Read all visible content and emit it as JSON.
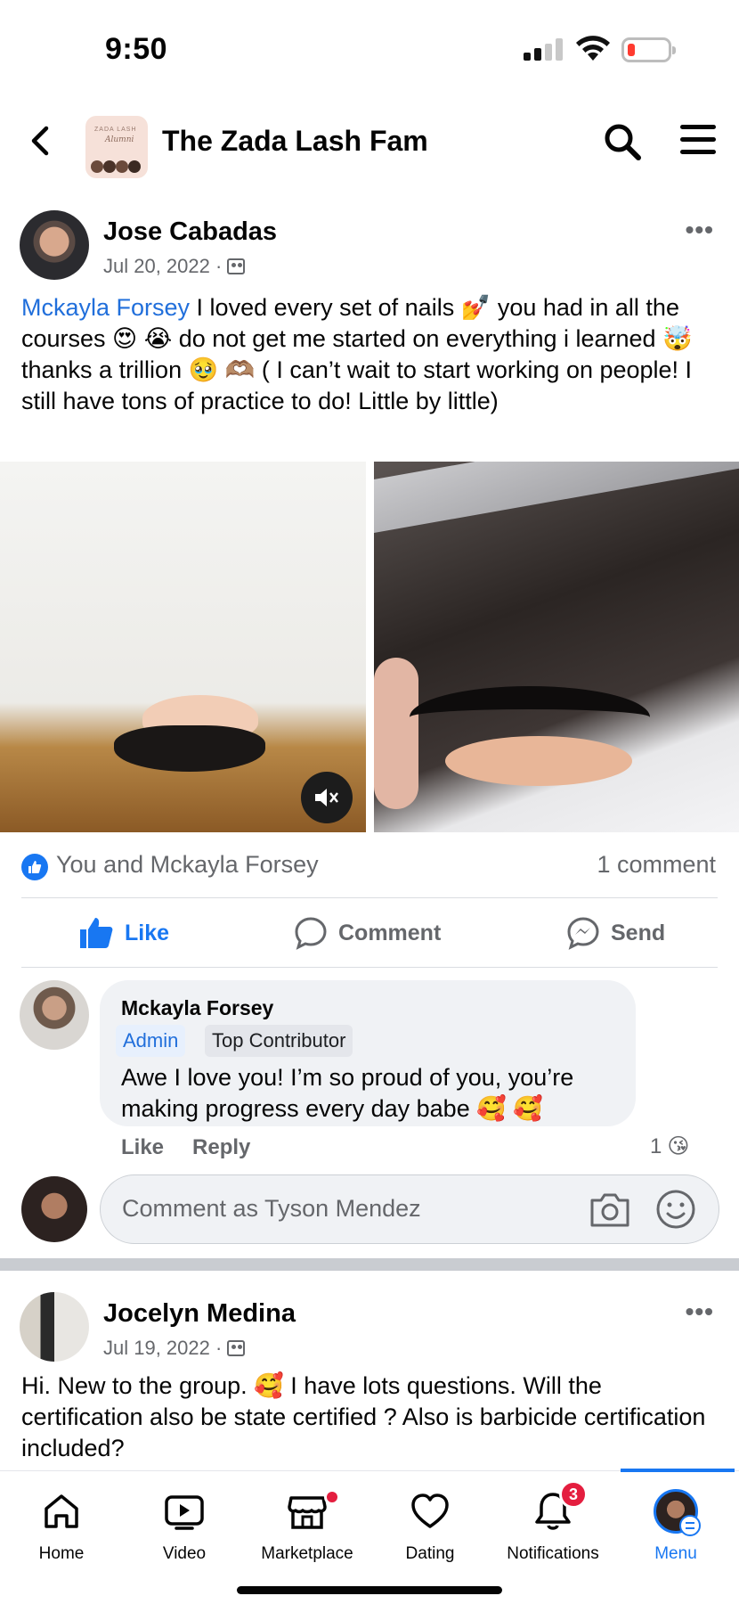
{
  "status_bar": {
    "time": "9:50"
  },
  "header": {
    "title": "The Zada Lash Fam",
    "thumb_line1": "ZADA LASH",
    "thumb_line2": "Alumni"
  },
  "post1": {
    "author": "Jose Cabadas",
    "date": "Jul 20, 2022 ·",
    "more": "•••",
    "mention": "Mckayla Forsey",
    "text_rest": " I loved every set of nails 💅 you had in all the courses 😍 😭 do not get me started on everything i learned 🤯 thanks a trillion 🥹 🫶🏽 ( I can’t wait to start working on people! I still have tons of practice to do! Little by little)",
    "reactors": "You and Mckayla Forsey",
    "comment_count": "1 comment",
    "actions": {
      "like": "Like",
      "comment": "Comment",
      "send": "Send"
    }
  },
  "comment": {
    "author": "Mckayla Forsey",
    "badge_admin": "Admin",
    "badge_top": "Top Contributor",
    "text": "Awe I love you! I’m so proud of you, you’re making progress every day babe 🥰 🥰",
    "like": "Like",
    "reply": "Reply",
    "reaction_count": "1",
    "reaction_emoji": "😘"
  },
  "composer": {
    "placeholder": "Comment as Tyson Mendez"
  },
  "post2": {
    "author": "Jocelyn Medina",
    "date": "Jul 19, 2022 ·",
    "more": "•••",
    "text": "Hi. New to the group. 🥰  I have lots questions.  Will the certification also be state certified ? Also is barbicide certification included?"
  },
  "nav": {
    "items": [
      {
        "label": "Home",
        "icon": "home-icon"
      },
      {
        "label": "Video",
        "icon": "video-icon"
      },
      {
        "label": "Marketplace",
        "icon": "marketplace-icon"
      },
      {
        "label": "Dating",
        "icon": "dating-icon"
      },
      {
        "label": "Notifications",
        "icon": "bell-icon",
        "badge": "3"
      },
      {
        "label": "Menu",
        "icon": "profile-menu-icon"
      }
    ],
    "active": "Menu"
  },
  "colors": {
    "accent": "#1877f2",
    "notification_red": "#e41e3f",
    "secondary_text": "#65676b"
  }
}
